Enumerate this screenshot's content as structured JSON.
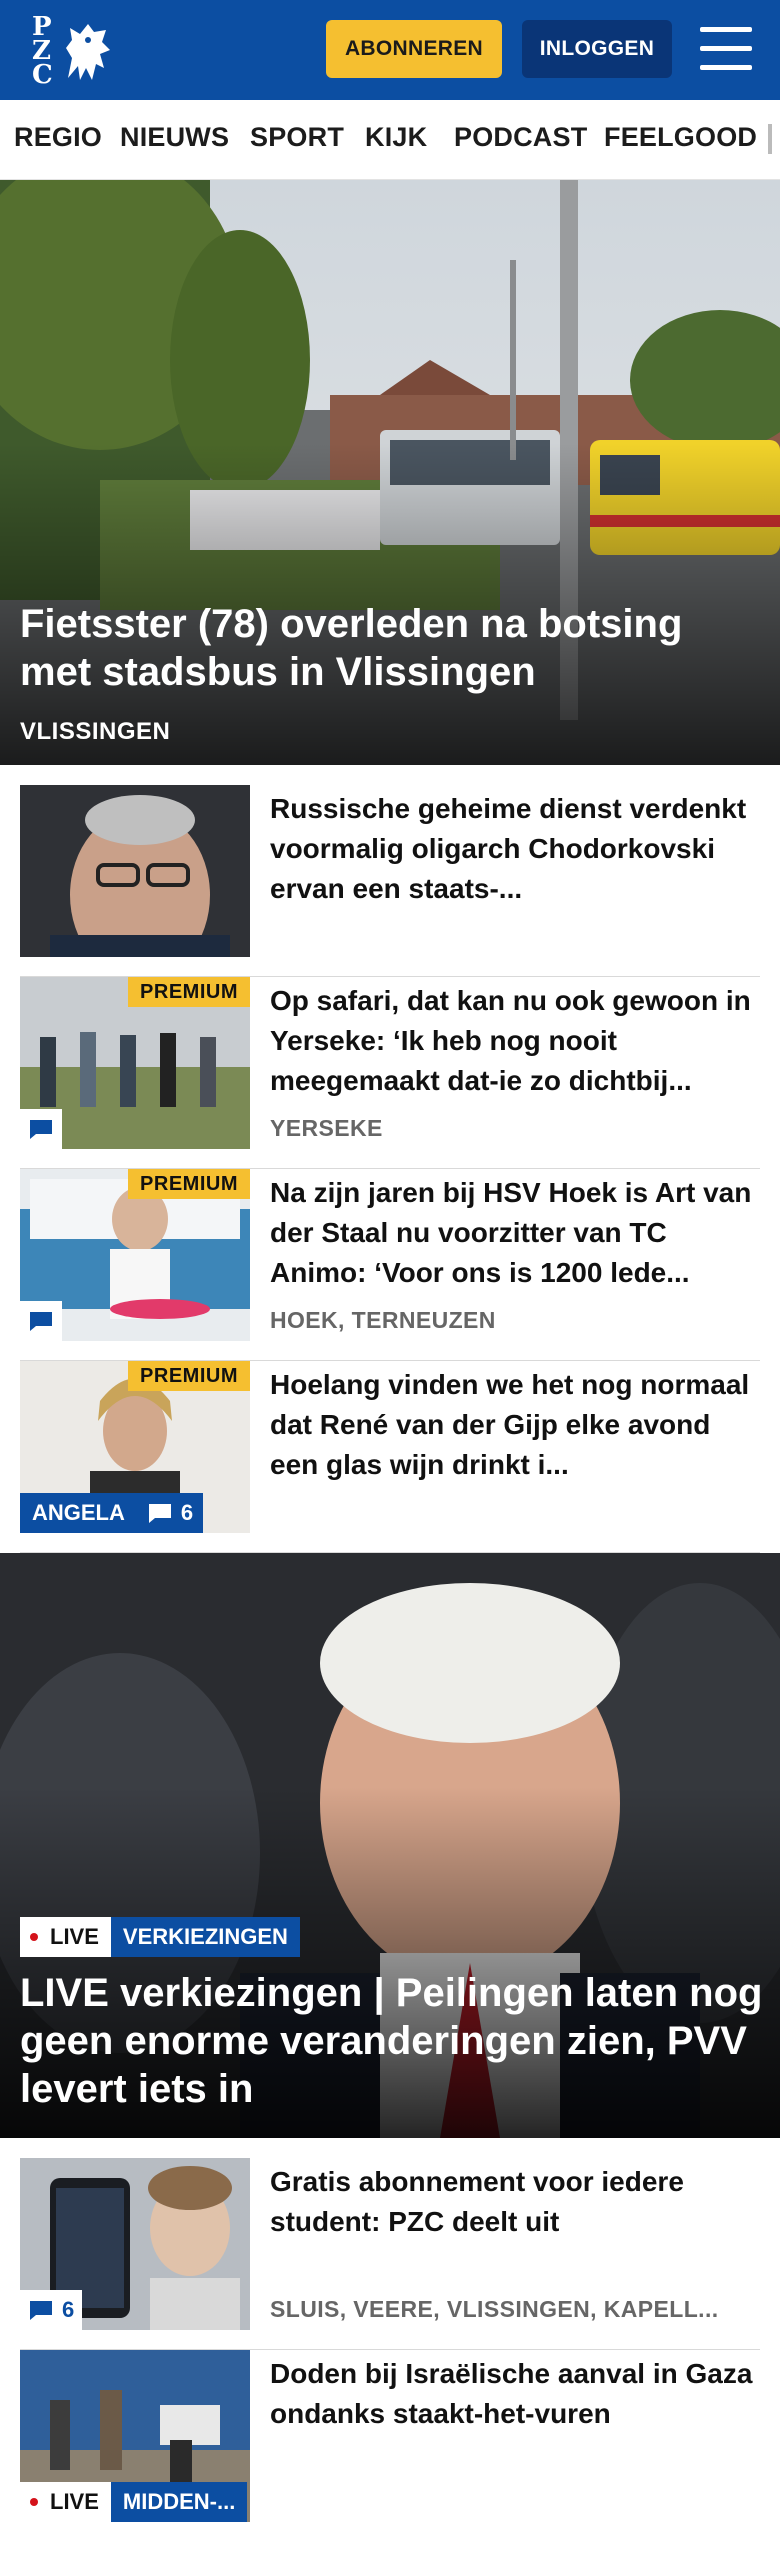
{
  "header": {
    "logo_letters": [
      "P",
      "Z",
      "C"
    ],
    "subscribe_label": "ABONNEREN",
    "login_label": "INLOGGEN",
    "menu_icon": "hamburger-menu-icon"
  },
  "nav": {
    "items": [
      "REGIO",
      "NIEUWS",
      "SPORT",
      "KIJK",
      "PODCAST",
      "FEELGOOD"
    ]
  },
  "hero": {
    "title": "Fietsster (78) overleden na botsing met stadsbus in Vlissingen",
    "location": "VLISSINGEN"
  },
  "articles": [
    {
      "title": "Russische geheime dienst verdenkt voormalig oligarch Chodorkovski ervan een staats-...",
      "location": "",
      "premium": false
    },
    {
      "title": "Op safari, dat kan nu ook gewoon in Yerseke: ‘Ik heb nog nooit meegemaakt dat-ie zo dichtbij...",
      "location": "YERSEKE",
      "premium": true,
      "premium_label": "PREMIUM"
    },
    {
      "title": "Na zijn jaren bij HSV Hoek is Art van der Staal nu voorzitter van TC Animo: ‘Voor ons is 1200 lede...",
      "location": "HOEK, TERNEUZEN",
      "premium": true,
      "premium_label": "PREMIUM"
    },
    {
      "title": "Hoelang vinden we het nog normaal dat René van der Gijp elke avond een glas wijn drinkt i...",
      "location": "",
      "premium": true,
      "premium_label": "PREMIUM",
      "tag": "ANGELA",
      "comments": "6"
    }
  ],
  "live_hero": {
    "live_label": "LIVE",
    "category": "VERKIEZINGEN",
    "title": "LIVE verkiezingen | Peilingen laten nog geen enorme veranderingen zien, PVV levert iets in"
  },
  "articles2": [
    {
      "title": "Gratis abonnement voor iedere student: PZC deelt uit",
      "location": "SLUIS, VEERE, VLISSINGEN, KAPELL...",
      "comments": "6"
    },
    {
      "title": "Doden bij Israëlische aanval in Gaza ondanks staakt-het-vuren",
      "location": "",
      "live_label": "LIVE",
      "category": "MIDDEN-..."
    }
  ],
  "colors": {
    "brand_blue": "#0c4ea2",
    "dark_blue": "#0a3577",
    "premium_yellow": "#f5bf30",
    "live_red": "#d4131b"
  }
}
